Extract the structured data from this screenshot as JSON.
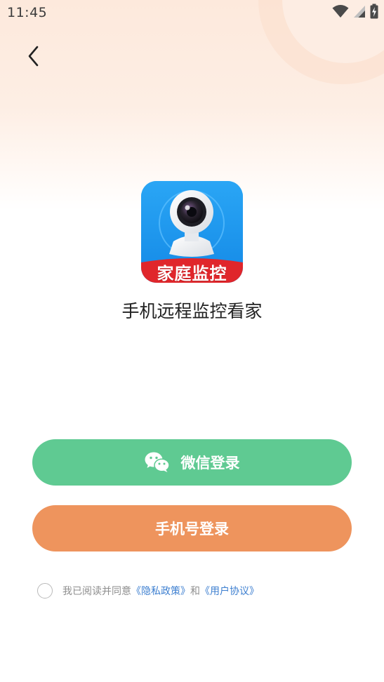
{
  "status_bar": {
    "time": "11:45",
    "icons": [
      "wifi-icon",
      "signal-icon",
      "battery-charging-icon"
    ]
  },
  "header": {
    "back_icon": "chevron-left-icon"
  },
  "app": {
    "icon_label": "家庭监控",
    "title": "手机远程监控看家"
  },
  "buttons": {
    "wechat_label": "微信登录",
    "phone_label": "手机号登录"
  },
  "agreement": {
    "prefix": "我已阅读并同意",
    "privacy_link": "《隐私政策》",
    "conjunction": "和",
    "user_link": "《用户协议》",
    "checked": false
  },
  "colors": {
    "wechat_button": "#5fca92",
    "phone_button": "#ee945d",
    "link": "#3d7fd0",
    "app_icon_bg": "#1a9af0",
    "app_icon_banner": "#e0262b"
  }
}
